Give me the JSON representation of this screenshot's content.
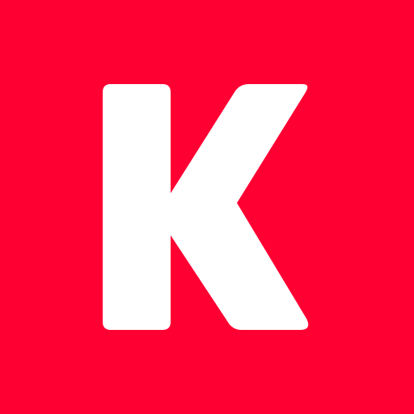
{
  "logo": {
    "letter": "K",
    "background_color": "#FF0033",
    "glyph_color": "#FFFFFF",
    "icon": "k-letter-logo-icon"
  }
}
